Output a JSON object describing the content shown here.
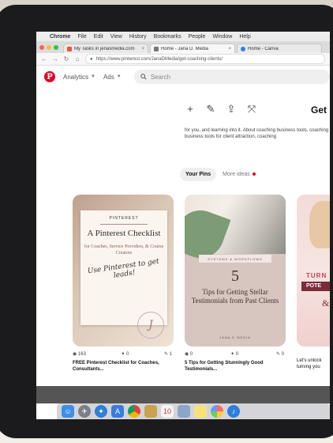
{
  "menubar": {
    "items": [
      "Chrome",
      "File",
      "Edit",
      "View",
      "History",
      "Bookmarks",
      "People",
      "Window",
      "Help"
    ]
  },
  "tabs": [
    {
      "title": "My Tasks in jenasmedia.com",
      "close": "×",
      "favicon_color": "#e8563f"
    },
    {
      "title": "Home - Jana D. Media",
      "close": "×",
      "favicon_color": "#777777"
    },
    {
      "title": "Home - Canva",
      "close": "",
      "favicon_color": "#2f80ed"
    }
  ],
  "address": {
    "url": "https://www.pinterest.com/JanaDMedia/get-coaching-clients/"
  },
  "pinterest": {
    "logo_letter": "P",
    "analytics_label": "Analytics",
    "ads_label": "Ads",
    "search_placeholder": "Search",
    "brand_color": "#e60023"
  },
  "profile": {
    "name": "Get",
    "bio": "for you, and learning into it. About coaching business tools, coaching business tools for client attraction, coaching"
  },
  "board_tabs": {
    "active": "Your Pins",
    "other": "More ideas"
  },
  "pins": [
    {
      "kicker": "PINTEREST",
      "title": "A Pinterest Checklist",
      "subtitle": "for Coaches, Service Providers, & Course Creators",
      "script": "Use Pinterest to get leads!",
      "seal": "J",
      "saves": "163",
      "reactions": "0",
      "comments": "1",
      "caption": "FREE Pinterest Checklist for Coaches, Consultants..."
    },
    {
      "tag": "SYSTEMS & WORKFLOWS",
      "number": "5",
      "title": "Tips for Getting Stellar Testimonials from Past Clients",
      "footer": "JANA D MEDIA",
      "saves": "0",
      "reactions": "0",
      "comments": "0",
      "caption": "5 Tips for Getting Stunningly Good Testimonials..."
    },
    {
      "band1": "TURN",
      "band2": "POTE",
      "amp": "&",
      "caption": "Let's unlock turning you"
    }
  ],
  "dock": {
    "icons": [
      "finder-icon",
      "launchpad-icon",
      "safari-icon",
      "appstore-icon",
      "chrome-icon",
      "notes-icon",
      "calendar-icon",
      "photos-icon",
      "stickies-icon",
      "photos2-icon",
      "music-icon"
    ]
  }
}
